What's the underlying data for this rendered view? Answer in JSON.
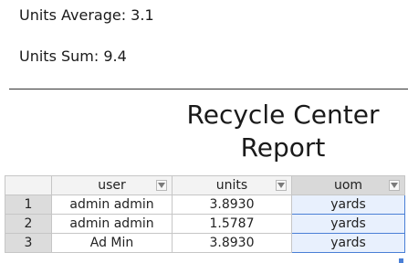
{
  "stats": {
    "average_label": "Units Average: 3.1",
    "sum_label": "Units Sum: 9.4"
  },
  "report": {
    "title_line1": "Recycle Center",
    "title_line2": "Report"
  },
  "table": {
    "columns": [
      "user",
      "units",
      "uom"
    ],
    "rows": [
      {
        "num": "1",
        "user": "admin admin",
        "units": "3.8930",
        "uom": "yards"
      },
      {
        "num": "2",
        "user": "admin admin",
        "units": "1.5787",
        "uom": "yards"
      },
      {
        "num": "3",
        "user": "Ad Min",
        "units": "3.8930",
        "uom": "yards"
      }
    ]
  },
  "colors": {
    "selection_border": "#4a7fd6",
    "selection_fill": "#e8f0fd"
  },
  "icons": [
    "filter-dropdown-icon"
  ]
}
